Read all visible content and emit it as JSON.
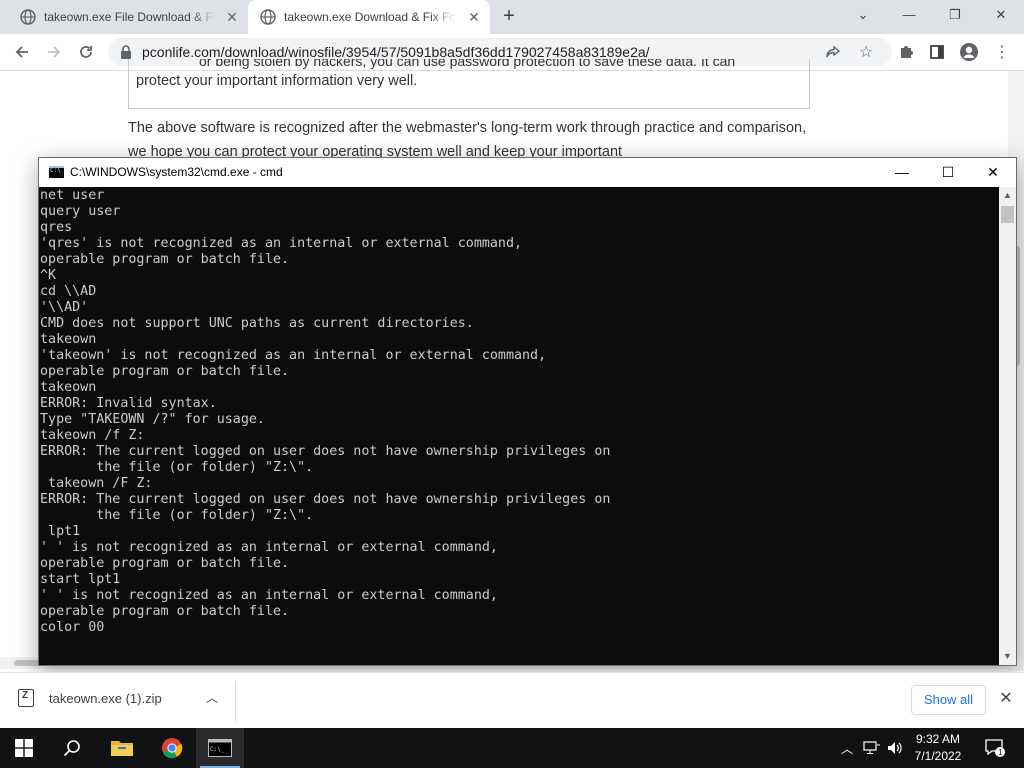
{
  "browser": {
    "tabs": [
      {
        "title": "takeown.exe File Download & Fix For Windows",
        "active": false
      },
      {
        "title": "takeown.exe Download & Fix For Windows",
        "active": true
      }
    ],
    "new_tab": "+",
    "url": "pconlife.com/download/winosfile/3954/57/5091b8a5df36dd179027458a83189e2a/"
  },
  "page": {
    "boxed_line1": "or being stolen by hackers, you can use password protection to save these data. It can",
    "boxed_line2": "protect your important information very well.",
    "paragraph": "The above software is recognized after the webmaster's long-term work through practice and comparison, we hope you can protect your operating system well and keep your important"
  },
  "cmd": {
    "title": "C:\\WINDOWS\\system32\\cmd.exe - cmd",
    "lines": [
      "net user",
      "query user",
      "qres",
      "'qres' is not recognized as an internal or external command,",
      "operable program or batch file.",
      "^K",
      "cd \\\\AD",
      "'\\\\AD'",
      "CMD does not support UNC paths as current directories.",
      "takeown",
      "'takeown' is not recognized as an internal or external command,",
      "operable program or batch file.",
      "takeown",
      "ERROR: Invalid syntax.",
      "Type \"TAKEOWN /?\" for usage.",
      "takeown /f Z:",
      "ERROR: The current logged on user does not have ownership privileges on",
      "       the file (or folder) \"Z:\\\".",
      " takeown /F Z:",
      "ERROR: The current logged on user does not have ownership privileges on",
      "       the file (or folder) \"Z:\\\".",
      " lpt1",
      "' ' is not recognized as an internal or external command,",
      "operable program or batch file.",
      "start lpt1",
      "' ' is not recognized as an internal or external command,",
      "operable program or batch file.",
      "color 00"
    ]
  },
  "downloads": {
    "file_name": "takeown.exe (1).zip",
    "show_all": "Show all"
  },
  "taskbar": {
    "time": "9:32 AM",
    "date": "7/1/2022",
    "notification_count": "1"
  },
  "colors": {
    "terminal_bg": "#0c0c0c",
    "terminal_fg": "#cccccc",
    "taskbar_bg": "#111214",
    "link_blue": "#1a73e8"
  }
}
